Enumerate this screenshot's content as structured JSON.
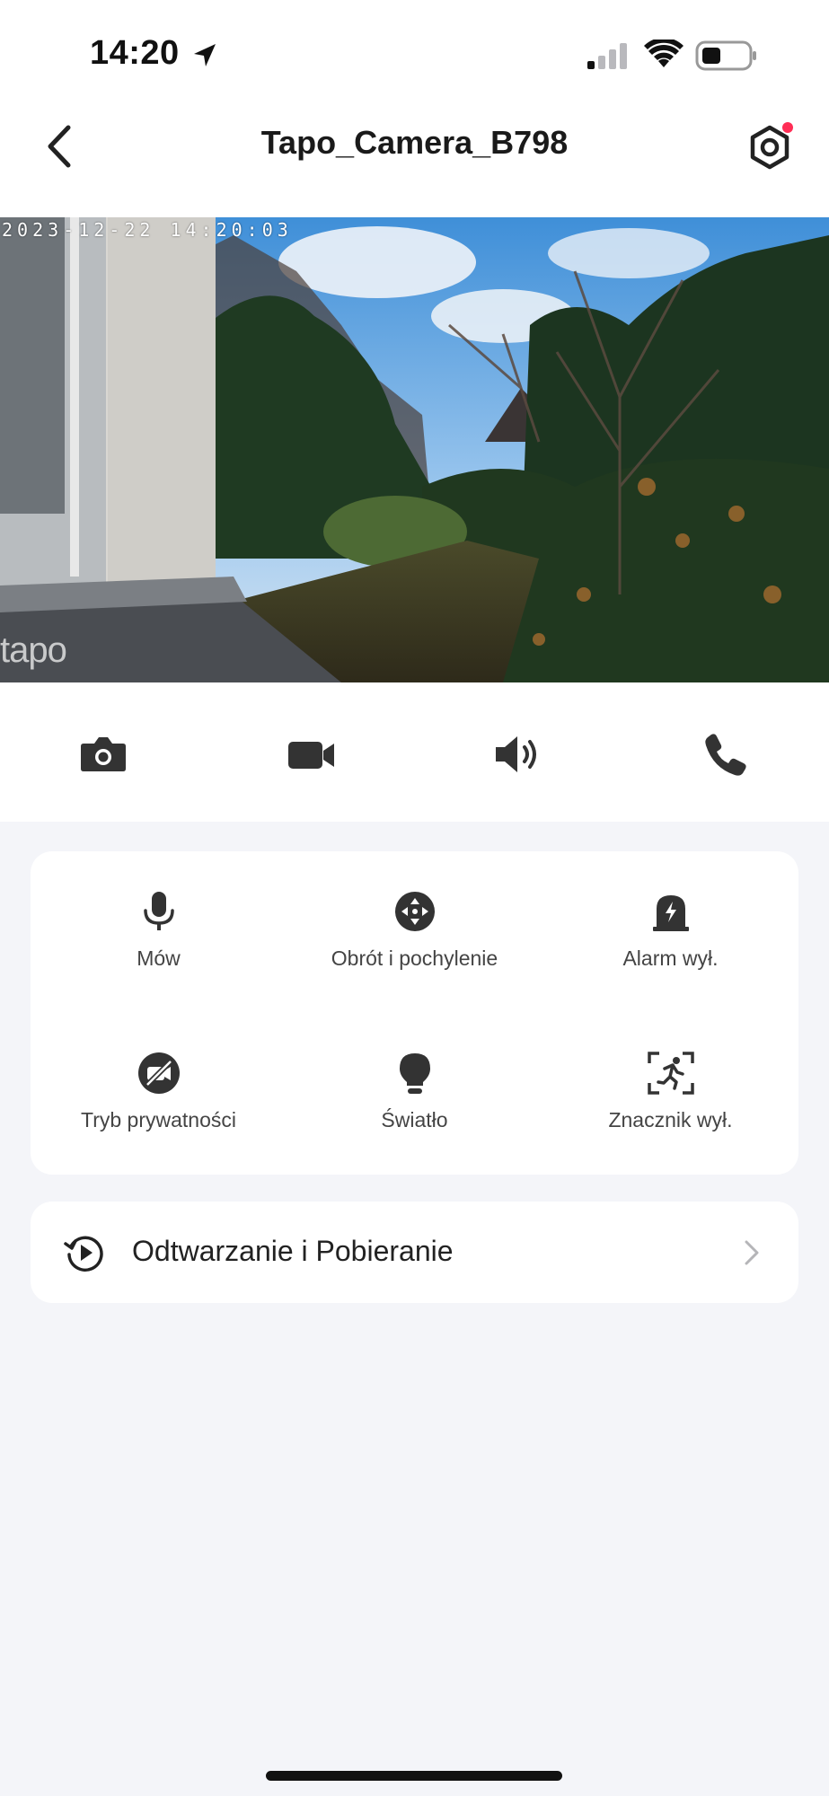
{
  "status_bar": {
    "time": "14:20",
    "location_icon": "location-arrow-icon",
    "signal_icon": "cellular-signal-icon",
    "wifi_icon": "wifi-icon",
    "battery_icon": "battery-icon"
  },
  "nav": {
    "title": "Tapo_Camera_B798",
    "back_icon": "chevron-left-icon",
    "settings_icon": "settings-hexagon-icon",
    "settings_badge_color": "#ff2d55"
  },
  "feed": {
    "timestamp": "2023-12-22 14:20:03",
    "watermark": "tapo"
  },
  "toolbar": {
    "items": [
      {
        "icon": "camera-snapshot-icon"
      },
      {
        "icon": "video-record-icon"
      },
      {
        "icon": "speaker-volume-icon"
      },
      {
        "icon": "phone-call-icon"
      }
    ]
  },
  "controls": [
    {
      "label": "Mów",
      "icon": "microphone-icon"
    },
    {
      "label": "Obrót i pochylenie",
      "icon": "pan-tilt-icon"
    },
    {
      "label": "Alarm wył.",
      "icon": "alarm-siren-icon"
    },
    {
      "label": "Tryb prywatności",
      "icon": "privacy-mode-icon"
    },
    {
      "label": "Światło",
      "icon": "light-bulb-icon"
    },
    {
      "label": "Znacznik wył.",
      "icon": "motion-marker-icon"
    }
  ],
  "playback": {
    "label": "Odtwarzanie i Pobieranie",
    "icon": "history-play-icon",
    "chevron_icon": "chevron-right-icon"
  },
  "colors": {
    "background": "#f4f5f9",
    "card": "#ffffff",
    "icon": "#333333",
    "badge": "#ff2d55"
  }
}
